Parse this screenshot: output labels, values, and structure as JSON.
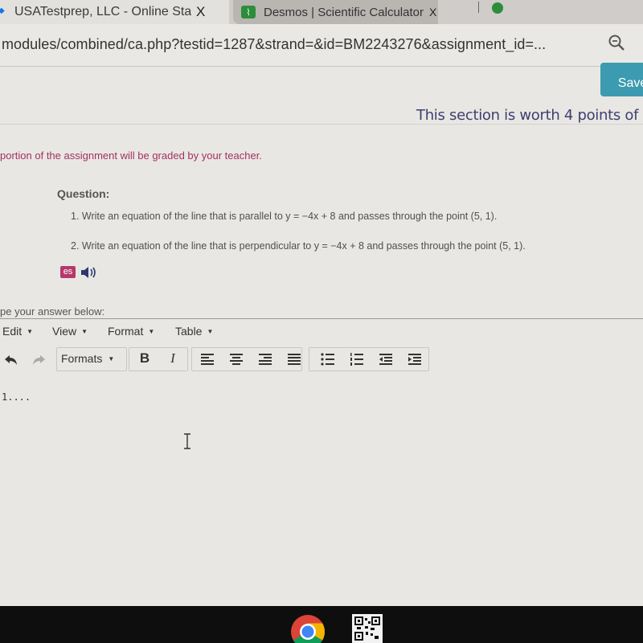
{
  "browser": {
    "tabs": [
      {
        "title": "USATestprep, LLC - Online Sta",
        "active": true,
        "close": "X"
      },
      {
        "title": "Desmos | Scientific Calculator",
        "active": false,
        "close": "X",
        "icon": "desmos-icon"
      },
      {
        "title": "",
        "active": false,
        "icon": "green-circle-icon"
      }
    ],
    "url": "modules/combined/ca.php?testid=1287&strand=&id=BM2243276&assignment_id=...",
    "zoom_icon": "magnifier-minus-icon"
  },
  "page": {
    "save_label": "Save",
    "section_worth": "This section is worth 4 points of",
    "graded_note": "portion of the assignment will be graded by your teacher.",
    "question_label": "Question:",
    "questions": [
      "1. Write an equation of the line that is parallel to y = −4x + 8 and passes through the point (5, 1).",
      "2. Write an equation of the line that is perpendicular to y = −4x + 8 and passes through the point (5, 1)."
    ],
    "es_label": "es",
    "speaker_icon": "speaker-icon",
    "answer_label": "pe your answer below:"
  },
  "editor": {
    "menus": [
      "Edit",
      "View",
      "Format",
      "Table"
    ],
    "formats_label": "Formats",
    "bold_label": "B",
    "italic_label": "I",
    "toolbar_icons": [
      "undo-icon",
      "redo-icon",
      "align-left-icon",
      "align-center-icon",
      "align-right-icon",
      "align-justify-icon",
      "bullet-list-icon",
      "numbered-list-icon",
      "outdent-icon",
      "indent-icon"
    ],
    "content": "1...."
  },
  "taskbar": {
    "apps": [
      "chrome-icon",
      "qr-code-icon"
    ]
  },
  "colors": {
    "save_button": "#3c9bb0",
    "graded_note": "#a2325e",
    "section_worth": "#3d3f70",
    "es_badge": "#b23a6a"
  }
}
